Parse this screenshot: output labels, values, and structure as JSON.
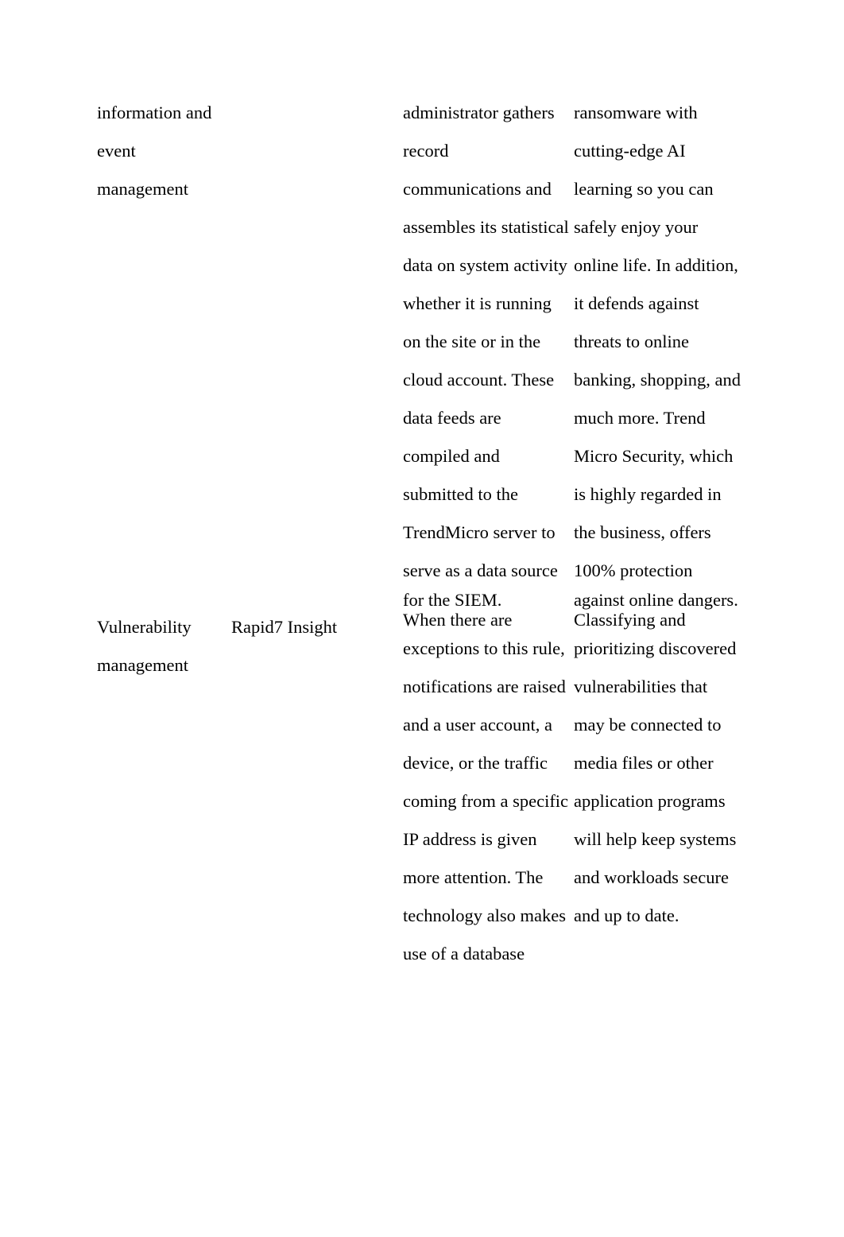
{
  "document": {
    "page_background": "#ffffff",
    "text_color": "#000000",
    "table": {
      "columns": [
        {
          "key": "term",
          "name": "security-capability-term"
        },
        {
          "key": "tool",
          "name": "security-tool-name"
        },
        {
          "key": "desc",
          "name": "description-text"
        },
        {
          "key": "benefit",
          "name": "benefit-text"
        }
      ],
      "rows": [
        {
          "name": "siem-row",
          "term_lines": [
            "information and",
            "event",
            "management"
          ],
          "tool_lines": [],
          "desc_lines": [
            "administrator gathers",
            "record",
            "communications and",
            "assembles its statistical",
            "data on system activity",
            "whether it is running",
            "on the site or in the",
            "cloud account. These",
            "data feeds are",
            "compiled and",
            "submitted to the",
            "TrendMicro server to",
            "serve as a data source",
            "for the SIEM."
          ],
          "benefit_lines": [
            "ransomware with",
            "cutting-edge AI",
            "learning so you can",
            "safely enjoy your",
            "online life. In addition,",
            "it defends against",
            "threats to online",
            "banking, shopping, and",
            "much more. Trend",
            "Micro Security, which",
            "is highly regarded in",
            "the business, offers",
            "100% protection",
            "against online dangers."
          ]
        },
        {
          "name": "vulnerability-management-row",
          "term_lines": [
            "Vulnerability",
            "management"
          ],
          "tool_lines": [
            "Rapid7 Insight"
          ],
          "desc_lines": [
            "When there are",
            "exceptions to this rule,",
            "notifications are raised",
            "and a user account, a",
            "device, or the traffic",
            "coming from a specific",
            "IP address is given",
            "more attention. The",
            "technology also makes",
            "use of a database"
          ],
          "benefit_lines": [
            "Classifying and",
            "prioritizing discovered",
            "vulnerabilities that",
            "may be connected to",
            "media files or other",
            "application programs",
            "will help keep systems",
            "and workloads secure",
            "and up to date."
          ]
        }
      ]
    }
  }
}
